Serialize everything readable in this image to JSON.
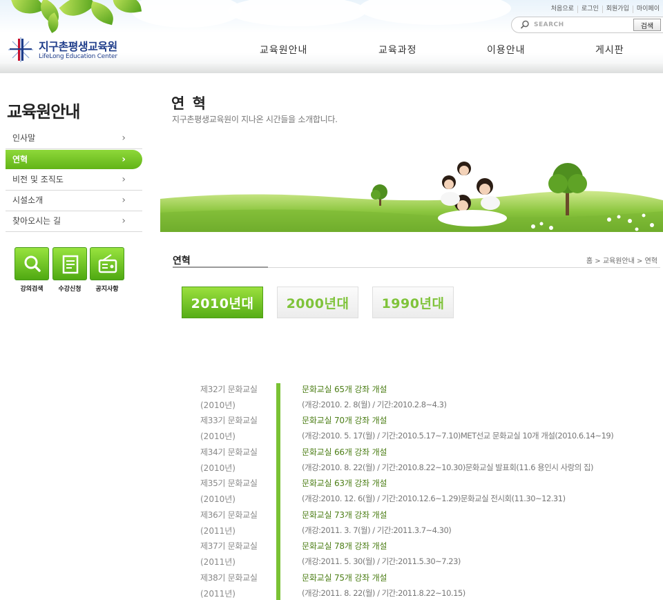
{
  "header": {
    "logo_ko": "지구촌평생교육원",
    "logo_en": "LifeLong Education Center",
    "util_links": [
      "처음으로",
      "로그인",
      "회원가입",
      "마이페이"
    ],
    "search_placeholder": "SEARCH",
    "search_button": "검색",
    "nav": [
      "교육원안내",
      "교육과정",
      "이용안내",
      "게시판"
    ]
  },
  "sidebar": {
    "title": "교육원안내",
    "items": [
      {
        "label": "인사말"
      },
      {
        "label": "연혁"
      },
      {
        "label": "비전 및 조직도"
      },
      {
        "label": "시설소개"
      },
      {
        "label": "찾아오시는 길"
      }
    ],
    "active_index": 1,
    "quick_links": [
      {
        "label": "강의검색",
        "icon": "search-icon"
      },
      {
        "label": "수강신청",
        "icon": "document-icon"
      },
      {
        "label": "공지사항",
        "icon": "radio-icon"
      }
    ]
  },
  "content": {
    "title": "연 혁",
    "subtitle": "지구촌평생교육원이 지나온 시간들을 소개합니다.",
    "section_title": "연혁",
    "breadcrumb": "홈 > 교육원안내 > 연혁",
    "decades": [
      "2010년대",
      "2000년대",
      "1990년대"
    ],
    "active_decade": 0,
    "timeline": [
      {
        "term": "제32기 문화교실",
        "year": "(2010년)",
        "title": "문화교실 65개 강좌 개설",
        "detail": "(개강:2010. 2. 8(월) / 기간:2010.2.8~4.3)"
      },
      {
        "term": "제33기 문화교실",
        "year": "(2010년)",
        "title": "문화교실 70개 강좌 개설",
        "detail": "(개강:2010. 5. 17(월) / 기간:2010.5.17~7.10)MET선교 문화교실 10개 개설(2010.6.14~19)"
      },
      {
        "term": "제34기 문화교실",
        "year": "(2010년)",
        "title": "문화교실 66개 강좌 개설",
        "detail": "(개강:2010. 8. 22(월) / 기간:2010.8.22~10.30)문화교실 발표회(11.6 용인시 사랑의 집)"
      },
      {
        "term": "제35기 문화교실",
        "year": "(2010년)",
        "title": "문화교실 63개 강좌 개설",
        "detail": "(개강:2010. 12. 6(월) / 기간:2010.12.6~1.29)문화교실 전시회(11.30~12.31)"
      },
      {
        "term": "제36기 문화교실",
        "year": "(2011년)",
        "title": "문화교실 73개 강좌 개설",
        "detail": "(개강:2011. 3. 7(월) / 기간:2011.3.7~4.30)"
      },
      {
        "term": "제37기 문화교실",
        "year": "(2011년)",
        "title": "문화교실 78개 강좌 개설",
        "detail": "(개강:2011. 5. 30(월) / 기간:2011.5.30~7.23)"
      },
      {
        "term": "제38기 문화교실",
        "year": "(2011년)",
        "title": "문화교실 75개 강좌 개설",
        "detail": "(개강:2011. 8. 22(월) / 기간:2011.8.22~10.15)"
      }
    ]
  },
  "colors": {
    "accent_green": "#62b417",
    "timeline_green": "#7ac234",
    "title_green": "#4c7e16",
    "logo_blue": "#1f3d8a"
  }
}
